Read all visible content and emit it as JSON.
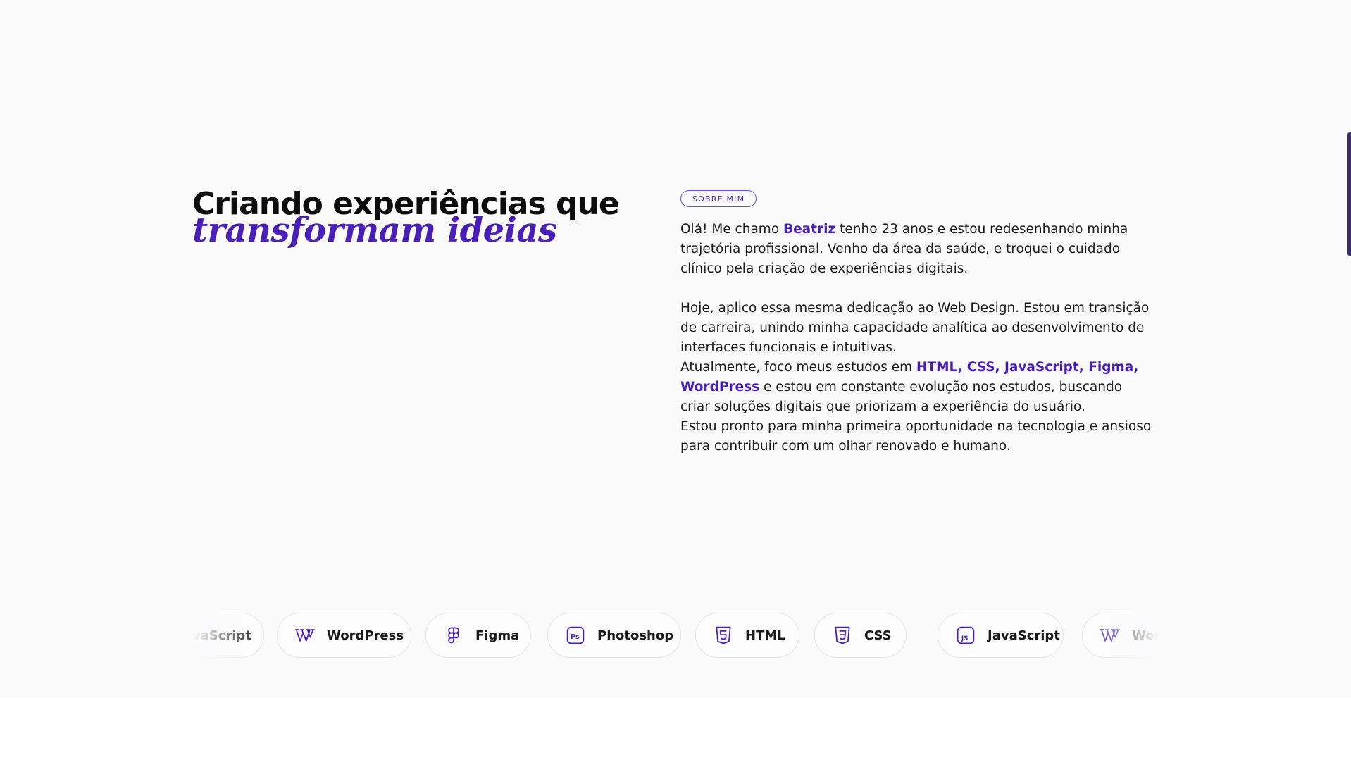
{
  "hero": {
    "title_line1": "Criando experiências que",
    "title_line2": "transformam ideias"
  },
  "about": {
    "badge": "SOBRE MIM",
    "p1": {
      "a": "Olá! Me chamo ",
      "name": "Beatriz",
      "b": " tenho 23 anos e estou redesenhando minha trajetória profissional. Venho da área da saúde, e troquei o cuidado clínico pela criação de experiências digitais."
    },
    "p2": "Hoje, aplico essa mesma dedicação ao Web Design. Estou em transição de carreira, unindo minha capacidade analítica ao desenvolvimento de interfaces funcionais e intuitivas.",
    "p3": {
      "a": "Atualmente, foco meus estudos em ",
      "skills": "HTML, CSS, JavaScript, Figma, WordPress",
      "b": " e estou em constante evolução nos estudos, buscando criar soluções digitais que priorizam a experiência do usuário."
    },
    "p4": "Estou pronto para minha primeira oportunidade na tecnologia e ansioso para contribuir com um olhar renovado e humano."
  },
  "skills": [
    {
      "label": "JavaScript",
      "icon": "javascript-icon"
    },
    {
      "label": "WordPress",
      "icon": "wordpress-icon"
    },
    {
      "label": "Figma",
      "icon": "figma-icon"
    },
    {
      "label": "Photoshop",
      "icon": "photoshop-icon"
    },
    {
      "label": "HTML",
      "icon": "html5-icon"
    },
    {
      "label": "CSS",
      "icon": "css3-icon"
    },
    {
      "label": "JavaScript",
      "icon": "javascript-icon"
    },
    {
      "label": "WordPress",
      "icon": "wordpress-icon"
    }
  ],
  "colors": {
    "accent": "#4a1fb8",
    "background": "#fafafb",
    "text": "#1a1a1a"
  }
}
